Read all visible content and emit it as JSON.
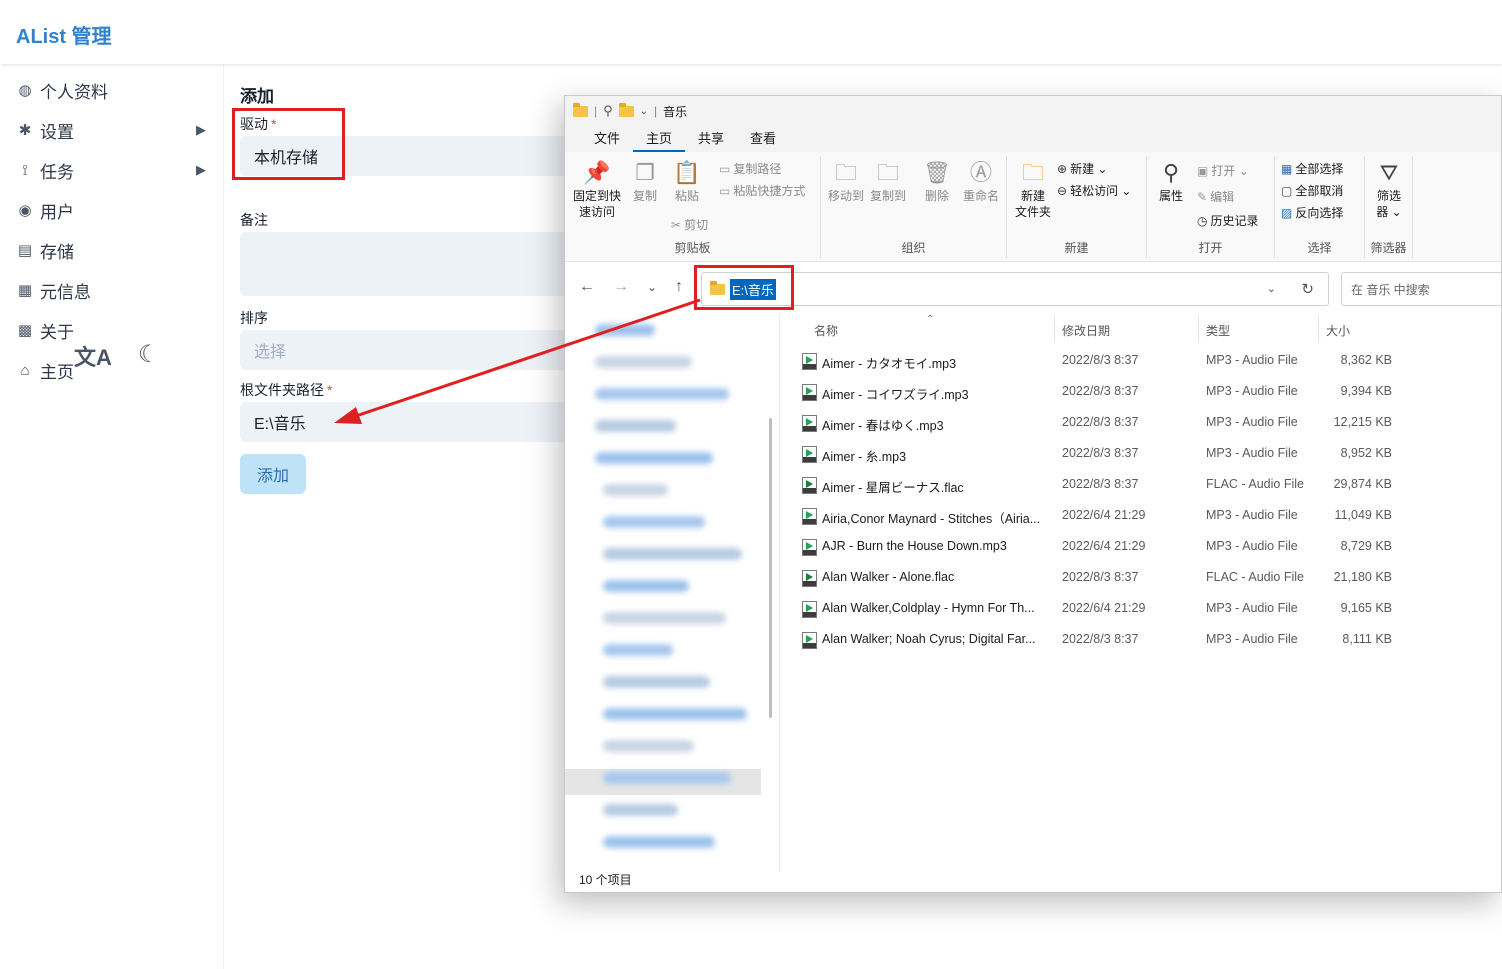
{
  "app": {
    "title": "AList 管理"
  },
  "sidebar": {
    "items": [
      {
        "label": "个人资料",
        "icon": "fingerprint-icon",
        "glyph": "◍",
        "has_arrow": false
      },
      {
        "label": "设置",
        "icon": "gear-icon",
        "glyph": "✱",
        "has_arrow": true
      },
      {
        "label": "任务",
        "icon": "tasks-icon",
        "glyph": "⟟",
        "has_arrow": true
      },
      {
        "label": "用户",
        "icon": "user-icon",
        "glyph": "◉",
        "has_arrow": false
      },
      {
        "label": "存储",
        "icon": "storage-icon",
        "glyph": "▤",
        "has_arrow": false
      },
      {
        "label": "元信息",
        "icon": "meta-icon",
        "glyph": "▦",
        "has_arrow": false
      },
      {
        "label": "关于",
        "icon": "chat-icon",
        "glyph": "▩",
        "has_arrow": false
      },
      {
        "label": "主页",
        "icon": "home-icon",
        "glyph": "⌂",
        "has_arrow": false
      }
    ],
    "arrow_glyph": "▶",
    "tools": {
      "translate_glyph": "文A",
      "moon_glyph": "☾"
    }
  },
  "form": {
    "heading": "添加",
    "driver": {
      "label": "驱动",
      "required": "*",
      "value": "本机存储"
    },
    "remark": {
      "label": "备注"
    },
    "order": {
      "label": "排序",
      "placeholder": "选择"
    },
    "root_path": {
      "label": "根文件夹路径",
      "required": "*",
      "value": "E:\\音乐"
    },
    "submit_label": "添加"
  },
  "explorer": {
    "title": "音乐",
    "menu_tabs": [
      "文件",
      "主页",
      "共享",
      "查看"
    ],
    "active_tab": "主页",
    "ribbon": {
      "clipboard": {
        "label": "剪贴板",
        "pin_line1": "固定到快",
        "pin_line2": "速访问",
        "copy": "复制",
        "paste": "粘贴",
        "copy_path": "复制路径",
        "paste_shortcut": "粘贴快捷方式",
        "cut": "剪切"
      },
      "organize": {
        "label": "组织",
        "move_to": "移动到",
        "copy_to": "复制到",
        "delete": "删除",
        "rename": "重命名"
      },
      "new": {
        "label": "新建",
        "new_folder_line1": "新建",
        "new_folder_line2": "文件夹",
        "new_item": "新建",
        "easy_access": "轻松访问"
      },
      "open": {
        "label": "打开",
        "properties": "属性",
        "open": "打开",
        "edit": "编辑",
        "history": "历史记录"
      },
      "select": {
        "label": "选择",
        "select_all": "全部选择",
        "select_none": "全部取消",
        "invert": "反向选择"
      },
      "filter": {
        "label": "筛选器",
        "filter_line1": "筛选",
        "filter_line2": "器"
      }
    },
    "address": "E:\\音乐",
    "search_placeholder": "在 音乐 中搜索",
    "columns": {
      "name": "名称",
      "date": "修改日期",
      "type": "类型",
      "size": "大小"
    },
    "files": [
      {
        "name": "Aimer - カタオモイ.mp3",
        "date": "2022/8/3 8:37",
        "type": "MP3 - Audio File",
        "size": "8,362 KB",
        "kind": "mp3"
      },
      {
        "name": "Aimer - コイワズライ.mp3",
        "date": "2022/8/3 8:37",
        "type": "MP3 - Audio File",
        "size": "9,394 KB",
        "kind": "mp3"
      },
      {
        "name": "Aimer - 春はゆく.mp3",
        "date": "2022/8/3 8:37",
        "type": "MP3 - Audio File",
        "size": "12,215 KB",
        "kind": "mp3"
      },
      {
        "name": "Aimer - 糸.mp3",
        "date": "2022/8/3 8:37",
        "type": "MP3 - Audio File",
        "size": "8,952 KB",
        "kind": "mp3"
      },
      {
        "name": "Aimer - 星屑ビーナス.flac",
        "date": "2022/8/3 8:37",
        "type": "FLAC - Audio File",
        "size": "29,874 KB",
        "kind": "flac"
      },
      {
        "name": "Airia,Conor Maynard - Stitches（Airia...",
        "date": "2022/6/4 21:29",
        "type": "MP3 - Audio File",
        "size": "11,049 KB",
        "kind": "mp3"
      },
      {
        "name": "AJR - Burn the House Down.mp3",
        "date": "2022/6/4 21:29",
        "type": "MP3 - Audio File",
        "size": "8,729 KB",
        "kind": "mp3"
      },
      {
        "name": "Alan Walker - Alone.flac",
        "date": "2022/8/3 8:37",
        "type": "FLAC - Audio File",
        "size": "21,180 KB",
        "kind": "flac"
      },
      {
        "name": "Alan Walker,Coldplay - Hymn For Th...",
        "date": "2022/6/4 21:29",
        "type": "MP3 - Audio File",
        "size": "9,165 KB",
        "kind": "mp3"
      },
      {
        "name": "Alan Walker; Noah Cyrus; Digital Far...",
        "date": "2022/8/3 8:37",
        "type": "MP3 - Audio File",
        "size": "8,111 KB",
        "kind": "mp3"
      }
    ],
    "status": "10 个项目",
    "nav_icons": {
      "back": "←",
      "forward": "→",
      "recent": "⌄",
      "up": "↑",
      "refresh": "↻",
      "dropdown": "⌄"
    }
  },
  "colors": {
    "accent": "#3182ce",
    "annotation": "#e02020",
    "explorer_selection": "#0067c0"
  }
}
